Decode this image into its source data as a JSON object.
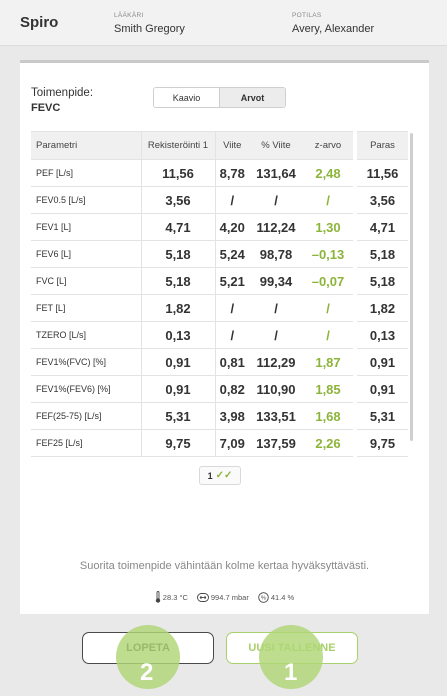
{
  "header": {
    "app_title": "Spiro",
    "doctor_label": "LÄÄKÄRI",
    "doctor_name": "Smith Gregory",
    "patient_label": "POTILAS",
    "patient_name": "Avery, Alexander"
  },
  "procedure": {
    "label": "Toimenpide:",
    "value": "FEVC"
  },
  "view_toggle": {
    "options": [
      "Kaavio",
      "Arvot"
    ],
    "selected": "Arvot"
  },
  "table": {
    "columns": [
      "Parametri",
      "Rekisteröinti 1",
      "Viite",
      "% Viite",
      "z-arvo"
    ],
    "best_column": "Paras",
    "rows": [
      {
        "param": "PEF [L/s]",
        "reg": "11,56",
        "ref": "8,78",
        "pct": "131,64",
        "z": "2,48",
        "best": "11,56"
      },
      {
        "param": "FEV0.5 [L/s]",
        "reg": "3,56",
        "ref": "/",
        "pct": "/",
        "z": "/",
        "best": "3,56"
      },
      {
        "param": "FEV1 [L]",
        "reg": "4,71",
        "ref": "4,20",
        "pct": "112,24",
        "z": "1,30",
        "best": "4,71"
      },
      {
        "param": "FEV6 [L]",
        "reg": "5,18",
        "ref": "5,24",
        "pct": "98,78",
        "z": "–0,13",
        "best": "5,18"
      },
      {
        "param": "FVC [L]",
        "reg": "5,18",
        "ref": "5,21",
        "pct": "99,34",
        "z": "–0,07",
        "best": "5,18"
      },
      {
        "param": "FET [L]",
        "reg": "1,82",
        "ref": "/",
        "pct": "/",
        "z": "/",
        "best": "1,82"
      },
      {
        "param": "TZERO [L/s]",
        "reg": "0,13",
        "ref": "/",
        "pct": "/",
        "z": "/",
        "best": "0,13"
      },
      {
        "param": "FEV1%(FVC) [%]",
        "reg": "0,91",
        "ref": "0,81",
        "pct": "112,29",
        "z": "1,87",
        "best": "0,91"
      },
      {
        "param": "FEV1%(FEV6) [%]",
        "reg": "0,91",
        "ref": "0,82",
        "pct": "110,90",
        "z": "1,85",
        "best": "0,91"
      },
      {
        "param": "FEF(25-75) [L/s]",
        "reg": "5,31",
        "ref": "3,98",
        "pct": "133,51",
        "z": "1,68",
        "best": "5,31"
      },
      {
        "param": "FEF25 [L/s]",
        "reg": "9,75",
        "ref": "7,09",
        "pct": "137,59",
        "z": "2,26",
        "best": "9,75"
      }
    ]
  },
  "pagination": {
    "page": "1",
    "icon": "check-icon"
  },
  "instruction": "Suorita toimenpide vähintään kolme kertaa hyväksyttävästi.",
  "environment": {
    "temperature": "28.3 °C",
    "pressure": "994.7 mbar",
    "humidity": "41.4 %"
  },
  "buttons": {
    "stop_label": "LOPETA",
    "new_save_label": "UUSI TALLENNE"
  },
  "markers": {
    "stop": "2",
    "new_save": "1"
  },
  "colors": {
    "accent": "#a8d16b",
    "z_value": "#8db43a",
    "marker": "#b0d676"
  }
}
